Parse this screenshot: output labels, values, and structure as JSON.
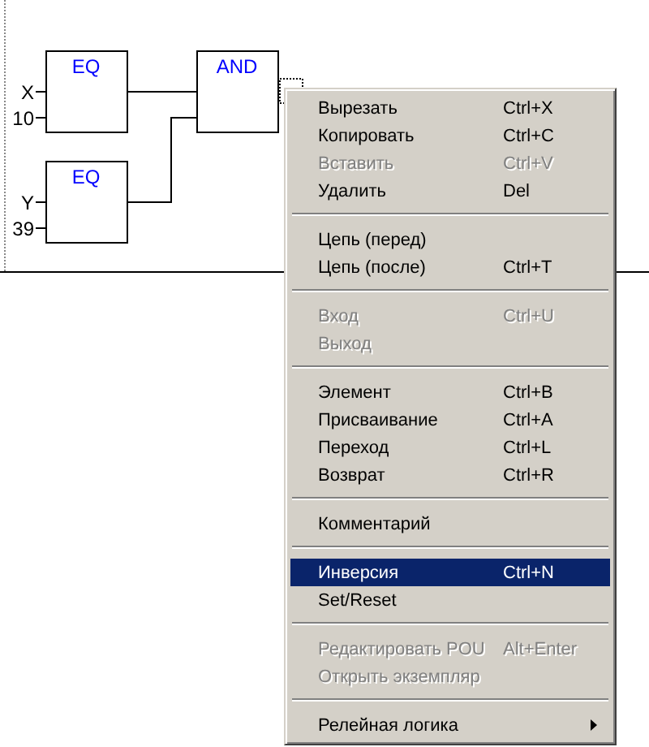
{
  "diagram": {
    "blocks": [
      {
        "title": "EQ",
        "inputs": [
          "X",
          "10"
        ]
      },
      {
        "title": "EQ",
        "inputs": [
          "Y",
          "39"
        ]
      },
      {
        "title": "AND"
      }
    ]
  },
  "context_menu": {
    "items": [
      {
        "kind": "item",
        "label": "Вырезать",
        "shortcut": "Ctrl+X",
        "disabled": false,
        "selected": false
      },
      {
        "kind": "item",
        "label": "Копировать",
        "shortcut": "Ctrl+C",
        "disabled": false,
        "selected": false
      },
      {
        "kind": "item",
        "label": "Вставить",
        "shortcut": "Ctrl+V",
        "disabled": true,
        "selected": false
      },
      {
        "kind": "item",
        "label": "Удалить",
        "shortcut": "Del",
        "disabled": false,
        "selected": false
      },
      {
        "kind": "separator"
      },
      {
        "kind": "item",
        "label": "Цепь (перед)",
        "disabled": false,
        "selected": false
      },
      {
        "kind": "item",
        "label": "Цепь (после)",
        "shortcut": "Ctrl+T",
        "disabled": false,
        "selected": false
      },
      {
        "kind": "separator"
      },
      {
        "kind": "item",
        "label": "Вход",
        "shortcut": "Ctrl+U",
        "disabled": true,
        "selected": false
      },
      {
        "kind": "item",
        "label": "Выход",
        "disabled": true,
        "selected": false
      },
      {
        "kind": "separator"
      },
      {
        "kind": "item",
        "label": "Элемент",
        "shortcut": "Ctrl+B",
        "disabled": false,
        "selected": false
      },
      {
        "kind": "item",
        "label": "Присваивание",
        "shortcut": "Ctrl+A",
        "disabled": false,
        "selected": false
      },
      {
        "kind": "item",
        "label": "Переход",
        "shortcut": "Ctrl+L",
        "disabled": false,
        "selected": false
      },
      {
        "kind": "item",
        "label": "Возврат",
        "shortcut": "Ctrl+R",
        "disabled": false,
        "selected": false
      },
      {
        "kind": "separator"
      },
      {
        "kind": "item",
        "label": "Комментарий",
        "disabled": false,
        "selected": false
      },
      {
        "kind": "separator"
      },
      {
        "kind": "item",
        "label": "Инверсия",
        "shortcut": "Ctrl+N",
        "disabled": false,
        "selected": true
      },
      {
        "kind": "item",
        "label": "Set/Reset",
        "disabled": false,
        "selected": false
      },
      {
        "kind": "separator"
      },
      {
        "kind": "item",
        "label": "Редактировать POU",
        "shortcut": "Alt+Enter",
        "disabled": true,
        "selected": false
      },
      {
        "kind": "item",
        "label": "Открыть экземпляр",
        "disabled": true,
        "selected": false
      },
      {
        "kind": "separator"
      },
      {
        "kind": "submenu",
        "label": "Релейная логика",
        "disabled": false,
        "selected": false
      }
    ]
  }
}
